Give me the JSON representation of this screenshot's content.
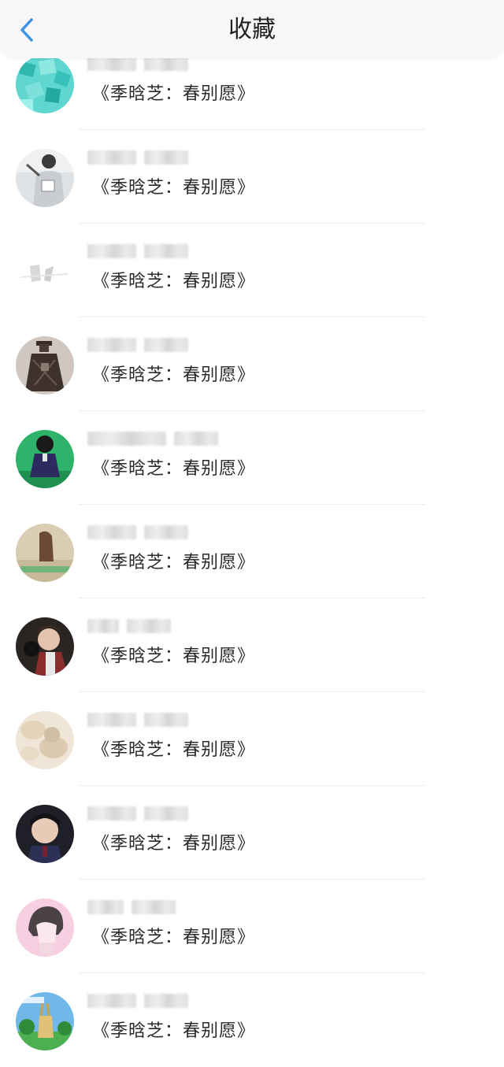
{
  "header": {
    "title": "收藏",
    "back_icon": "chevron-left-icon",
    "accent_color": "#3a93e6"
  },
  "items": [
    {
      "text": "《季晗芝：春别愿》",
      "avatar": "teal-candy"
    },
    {
      "text": "《季晗芝：春别愿》",
      "avatar": "person-hoodie"
    },
    {
      "text": "《季晗芝：春别愿》",
      "avatar": "sketch-white"
    },
    {
      "text": "《季晗芝：春别愿》",
      "avatar": "dark-figure"
    },
    {
      "text": "《季晗芝：春别愿》",
      "avatar": "green-girl"
    },
    {
      "text": "《季晗芝：春别愿》",
      "avatar": "girl-back"
    },
    {
      "text": "《季晗芝：春别愿》",
      "avatar": "boy-dark"
    },
    {
      "text": "《季晗芝：春别愿》",
      "avatar": "flower-beige"
    },
    {
      "text": "《季晗芝：春别愿》",
      "avatar": "boy-school"
    },
    {
      "text": "《季晗芝：春别愿》",
      "avatar": "anime-pink"
    },
    {
      "text": "《季晗芝：春别愿》",
      "avatar": "cartoon-sky"
    }
  ]
}
